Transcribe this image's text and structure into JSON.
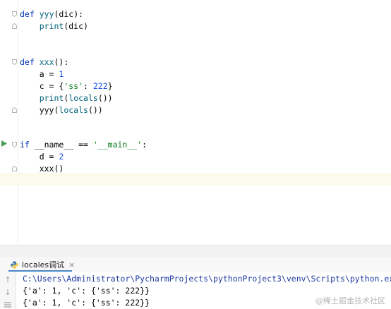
{
  "editor": {
    "lines": [
      {
        "text": "def yyy(dic):"
      },
      {
        "text": "    print(dic)"
      },
      {
        "text": "def xxx():"
      },
      {
        "text": "    a = 1"
      },
      {
        "text": "    c = {'ss': 222}"
      },
      {
        "text": "    print(locals())"
      },
      {
        "text": "    yyy(locals())"
      },
      {
        "text": "if __name__ == '__main__':"
      },
      {
        "text": "    d = 2"
      },
      {
        "text": "    xxx()"
      }
    ]
  },
  "run_panel": {
    "tab_label": "locales调试",
    "tab_close": "×",
    "icons": {
      "python": "python-file-icon",
      "up": "up-arrow-icon",
      "down": "down-arrow-icon",
      "wrap": "soft-wrap-icon",
      "run": "run-arrow-icon"
    },
    "console_lines": [
      "C:\\Users\\Administrator\\PycharmProjects\\pythonProject3\\venv\\Scripts\\python.exe C:/Users",
      "{'a': 1, 'c': {'ss': 222}}",
      "{'a': 1, 'c': {'ss': 222}}"
    ]
  },
  "watermark": {
    "text": "@稀土掘金技术社区"
  },
  "colors": {
    "keyword": "#0033b3",
    "function": "#00627a",
    "number": "#1750eb",
    "string": "#067d17",
    "run_arrow": "#499c54",
    "caret_line": "#fcfaed"
  }
}
